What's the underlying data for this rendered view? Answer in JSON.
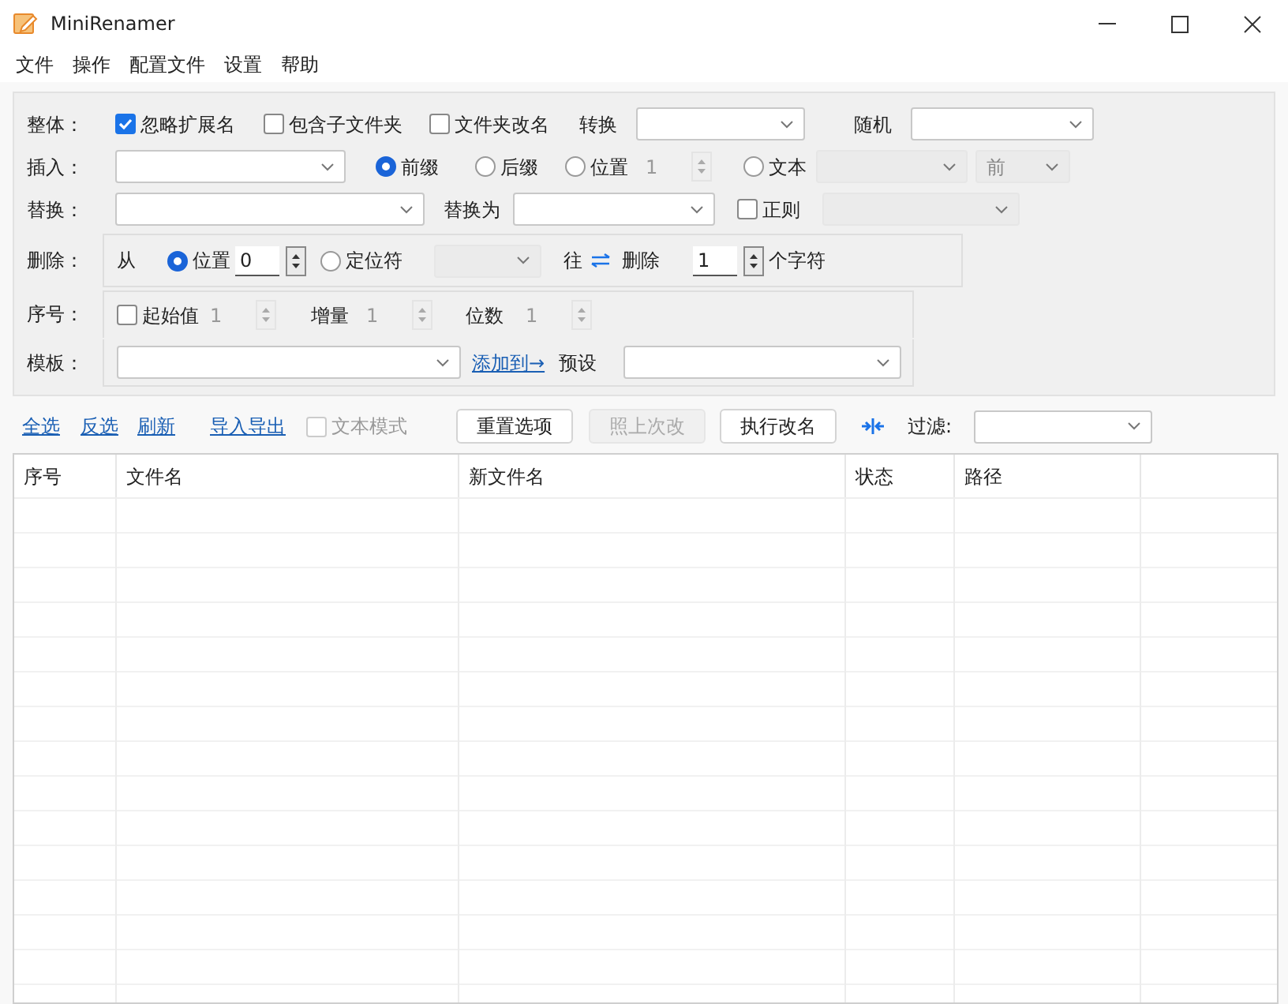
{
  "window": {
    "title": "MiniRenamer"
  },
  "menu": [
    "文件",
    "操作",
    "配置文件",
    "设置",
    "帮助"
  ],
  "options": [
    {
      "label": "整体：",
      "items": [
        {
          "kind": "checkbox",
          "label": "忽略扩展名",
          "checked": true
        },
        {
          "kind": "checkbox",
          "label": "包含子文件夹",
          "checked": false
        },
        {
          "kind": "checkbox",
          "label": "文件夹改名",
          "checked": false
        },
        {
          "kind": "text",
          "text": "转换"
        },
        {
          "kind": "combo",
          "disabled": false
        },
        {
          "kind": "text",
          "text": "随机"
        },
        {
          "kind": "combo",
          "disabled": false
        }
      ]
    },
    {
      "label": "插入：",
      "items": [
        {
          "kind": "combo",
          "disabled": false
        },
        {
          "kind": "radio",
          "label": "前缀",
          "selected": true
        },
        {
          "kind": "radio",
          "label": "后缀",
          "selected": false
        },
        {
          "kind": "radio",
          "label": "位置",
          "selected": false
        },
        {
          "kind": "spin",
          "value": "1",
          "disabled": true
        },
        {
          "kind": "radio",
          "label": "文本",
          "selected": false
        },
        {
          "kind": "combo",
          "disabled": true
        },
        {
          "kind": "combo",
          "value": "前",
          "disabled": true
        }
      ]
    },
    {
      "label": "替换：",
      "items": [
        {
          "kind": "combo",
          "disabled": false
        },
        {
          "kind": "text",
          "text": "替换为"
        },
        {
          "kind": "combo",
          "disabled": false
        },
        {
          "kind": "checkbox",
          "label": "正则",
          "checked": false
        },
        {
          "kind": "combo",
          "disabled": true
        }
      ]
    },
    {
      "label": "删除：",
      "items": [
        {
          "kind": "text",
          "text": "从"
        },
        {
          "kind": "radio",
          "label": "位置",
          "selected": true
        },
        {
          "kind": "spin",
          "value": "0",
          "disabled": false
        },
        {
          "kind": "radio",
          "label": "定位符",
          "selected": false
        },
        {
          "kind": "combo",
          "disabled": true
        },
        {
          "kind": "text",
          "text": "往"
        },
        {
          "kind": "icon"
        },
        {
          "kind": "text",
          "text": "删除"
        },
        {
          "kind": "spin",
          "value": "1",
          "disabled": false
        },
        {
          "kind": "text",
          "text": "个字符"
        }
      ]
    },
    {
      "label": "序号：",
      "items": [
        {
          "kind": "checkbox",
          "label": "起始值",
          "checked": false
        },
        {
          "kind": "spin",
          "value": "1",
          "disabled": true
        },
        {
          "kind": "text",
          "text": "增量"
        },
        {
          "kind": "spin",
          "value": "1",
          "disabled": true
        },
        {
          "kind": "text",
          "text": "位数"
        },
        {
          "kind": "spin",
          "value": "1",
          "disabled": true
        }
      ]
    },
    {
      "label": "模板：",
      "items": [
        {
          "kind": "combo",
          "disabled": false
        },
        {
          "kind": "link",
          "text": "添加到→"
        },
        {
          "kind": "text",
          "text": "预设"
        },
        {
          "kind": "combo",
          "disabled": false
        }
      ]
    }
  ],
  "toolbar": [
    {
      "kind": "link",
      "text": "全选"
    },
    {
      "kind": "link",
      "text": "反选"
    },
    {
      "kind": "link",
      "text": "刷新"
    },
    {
      "kind": "link",
      "text": "导入导出"
    },
    {
      "kind": "checkbox",
      "label": "文本模式",
      "checked": false,
      "disabled": true
    },
    {
      "kind": "button",
      "text": "重置选项",
      "disabled": false
    },
    {
      "kind": "button",
      "text": "照上次改",
      "disabled": true
    },
    {
      "kind": "button",
      "text": "执行改名",
      "disabled": false
    },
    {
      "kind": "icon"
    },
    {
      "kind": "text",
      "text": "过滤:"
    },
    {
      "kind": "combo",
      "disabled": false
    }
  ],
  "table": {
    "columns": [
      "序号",
      "文件名",
      "新文件名",
      "状态",
      "路径"
    ]
  }
}
